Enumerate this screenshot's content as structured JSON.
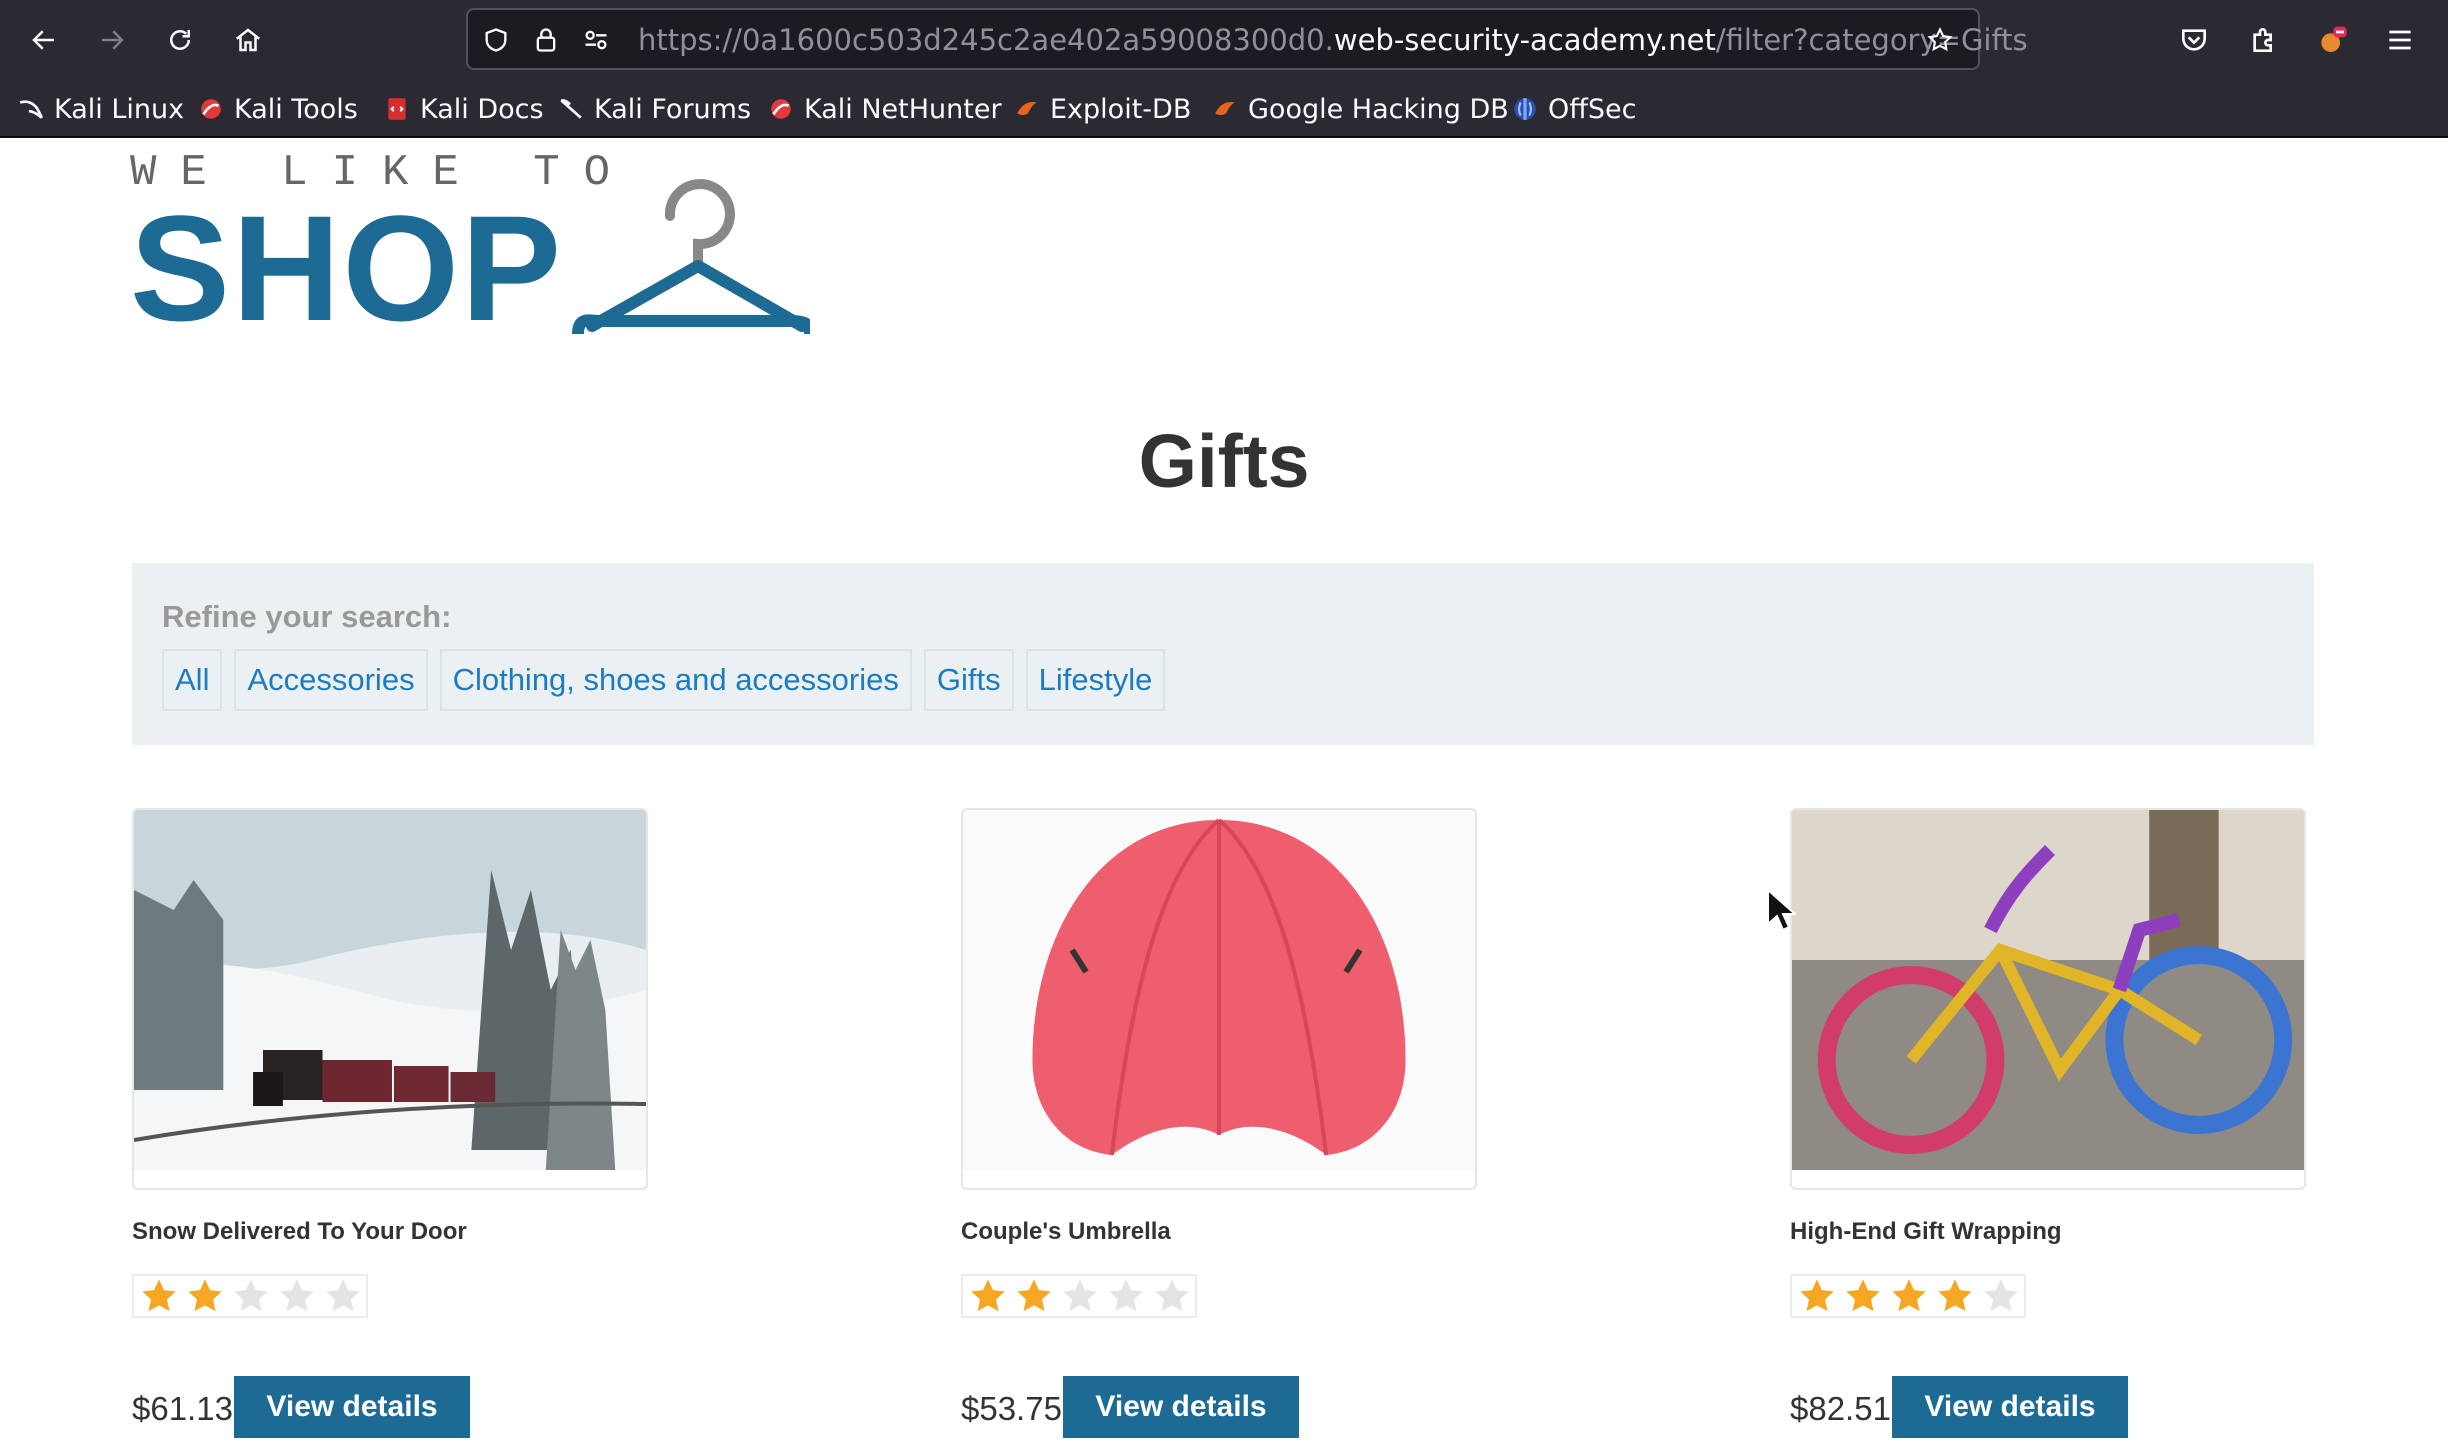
{
  "browser": {
    "url_prefix": "https://0a1600c503d245c2ae402a59008300d0.",
    "url_host": "web-security-academy.net",
    "url_path": "/filter?category=Gifts"
  },
  "bookmarks": [
    {
      "label": "Kali Linux"
    },
    {
      "label": "Kali Tools"
    },
    {
      "label": "Kali Docs"
    },
    {
      "label": "Kali Forums"
    },
    {
      "label": "Kali NetHunter"
    },
    {
      "label": "Exploit-DB"
    },
    {
      "label": "Google Hacking DB"
    },
    {
      "label": "OffSec"
    }
  ],
  "logo": {
    "top_text": "WE LIKE TO",
    "main_text": "SHOP"
  },
  "page": {
    "title": "Gifts",
    "refine_label": "Refine your search:",
    "filters": [
      "All",
      "Accessories",
      "Clothing, shoes and accessories",
      "Gifts",
      "Lifestyle"
    ]
  },
  "products": [
    {
      "name": "Snow Delivered To Your Door",
      "rating": 2,
      "price": "$61.13",
      "button": "View details"
    },
    {
      "name": "Couple's Umbrella",
      "rating": 2,
      "price": "$53.75",
      "button": "View details"
    },
    {
      "name": "High-End Gift Wrapping",
      "rating": 4,
      "price": "$82.51",
      "button": "View details"
    }
  ],
  "colors": {
    "brand": "#1d6b94",
    "link": "#1d7bbf",
    "star_filled": "#f5a623",
    "star_empty": "#e0e0e0"
  }
}
